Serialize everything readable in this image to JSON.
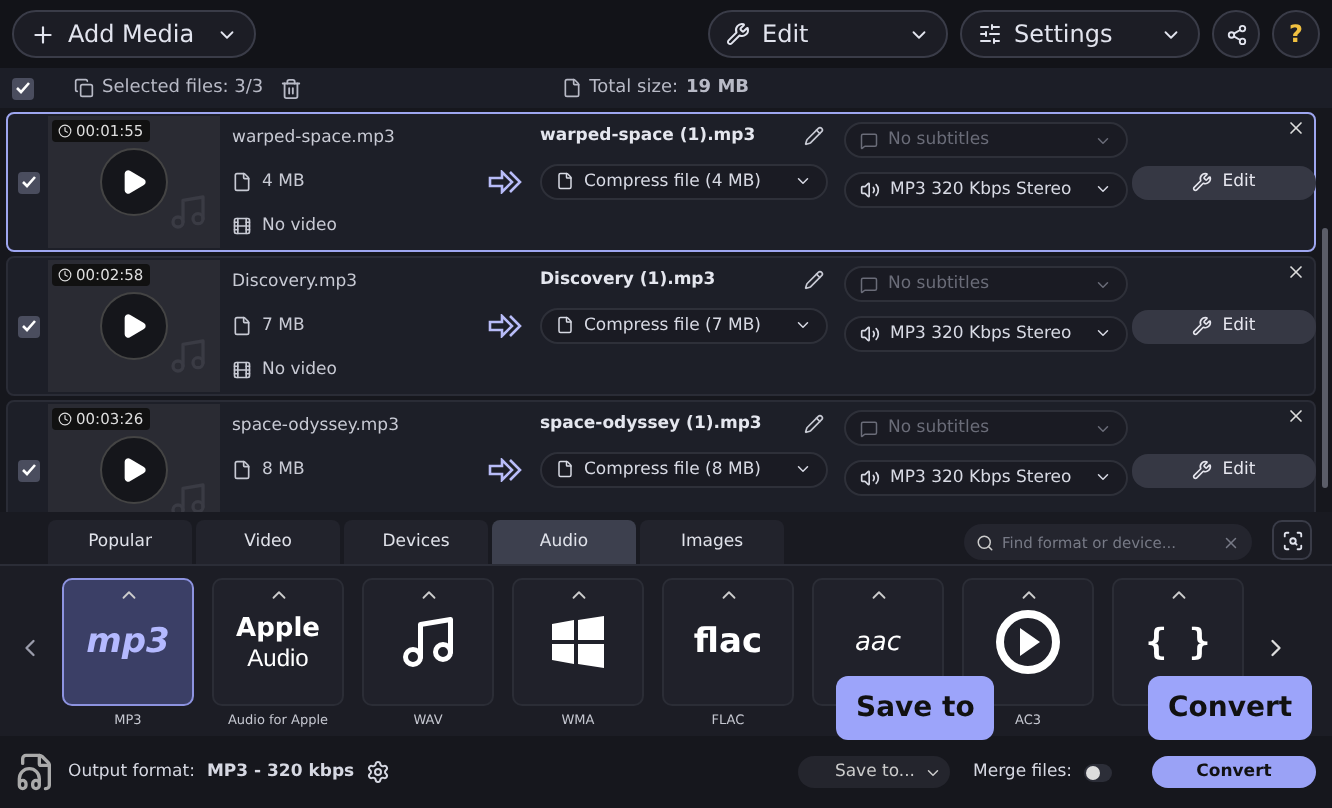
{
  "toolbar": {
    "add_media": "Add Media",
    "edit": "Edit",
    "settings": "Settings",
    "help": "?"
  },
  "selection": {
    "checked": true,
    "selected_files": "Selected files: 3/3",
    "total_label": "Total size:",
    "total_value": "19 MB"
  },
  "files": [
    {
      "checked": true,
      "selected": true,
      "duration": "00:01:55",
      "name": "warped-space.mp3",
      "size": "4 MB",
      "video": "No video",
      "output": "warped-space (1).mp3",
      "subtitles": "No subtitles",
      "compress": "Compress file (4 MB)",
      "audio": "MP3 320 Kbps Stereo",
      "edit": "Edit"
    },
    {
      "checked": true,
      "selected": false,
      "duration": "00:02:58",
      "name": "Discovery.mp3",
      "size": "7 MB",
      "video": "No video",
      "output": "Discovery (1).mp3",
      "subtitles": "No subtitles",
      "compress": "Compress file (7 MB)",
      "audio": "MP3 320 Kbps Stereo",
      "edit": "Edit"
    },
    {
      "checked": true,
      "selected": false,
      "duration": "00:03:26",
      "name": "space-odyssey.mp3",
      "size": "8 MB",
      "output": "space-odyssey (1).mp3",
      "subtitles": "No subtitles",
      "compress": "Compress file (8 MB)",
      "audio": "MP3 320 Kbps Stereo",
      "edit": "Edit"
    }
  ],
  "tabs": [
    {
      "label": "Popular",
      "selected": false
    },
    {
      "label": "Video",
      "selected": false
    },
    {
      "label": "Devices",
      "selected": false
    },
    {
      "label": "Audio",
      "selected": true
    },
    {
      "label": "Images",
      "selected": false
    }
  ],
  "search": {
    "placeholder": "Find format or device..."
  },
  "formats": [
    {
      "kind": "mp3",
      "logo": "mp3",
      "label": "MP3",
      "selected": true
    },
    {
      "kind": "apple",
      "logo": "Apple",
      "logo_sub": "Audio",
      "label": "Audio for Apple",
      "selected": false
    },
    {
      "kind": "note",
      "label": "WAV",
      "selected": false
    },
    {
      "kind": "windows",
      "label": "WMA",
      "selected": false
    },
    {
      "kind": "flac",
      "logo": "flac",
      "label": "FLAC",
      "selected": false
    },
    {
      "kind": "aac",
      "logo": "aac",
      "selected": false
    },
    {
      "kind": "play",
      "label": "AC3",
      "selected": false
    },
    {
      "kind": "braces",
      "logo": "{ }",
      "selected": false
    }
  ],
  "footer": {
    "output_label": "Output format:",
    "output_value": "MP3 - 320 kbps",
    "save_to": "Save to...",
    "merge_label": "Merge files:",
    "merge_on": false,
    "convert": "Convert"
  },
  "tooltips": [
    {
      "kind": "save",
      "text": "Save to"
    },
    {
      "kind": "convert",
      "text": "Convert"
    }
  ]
}
